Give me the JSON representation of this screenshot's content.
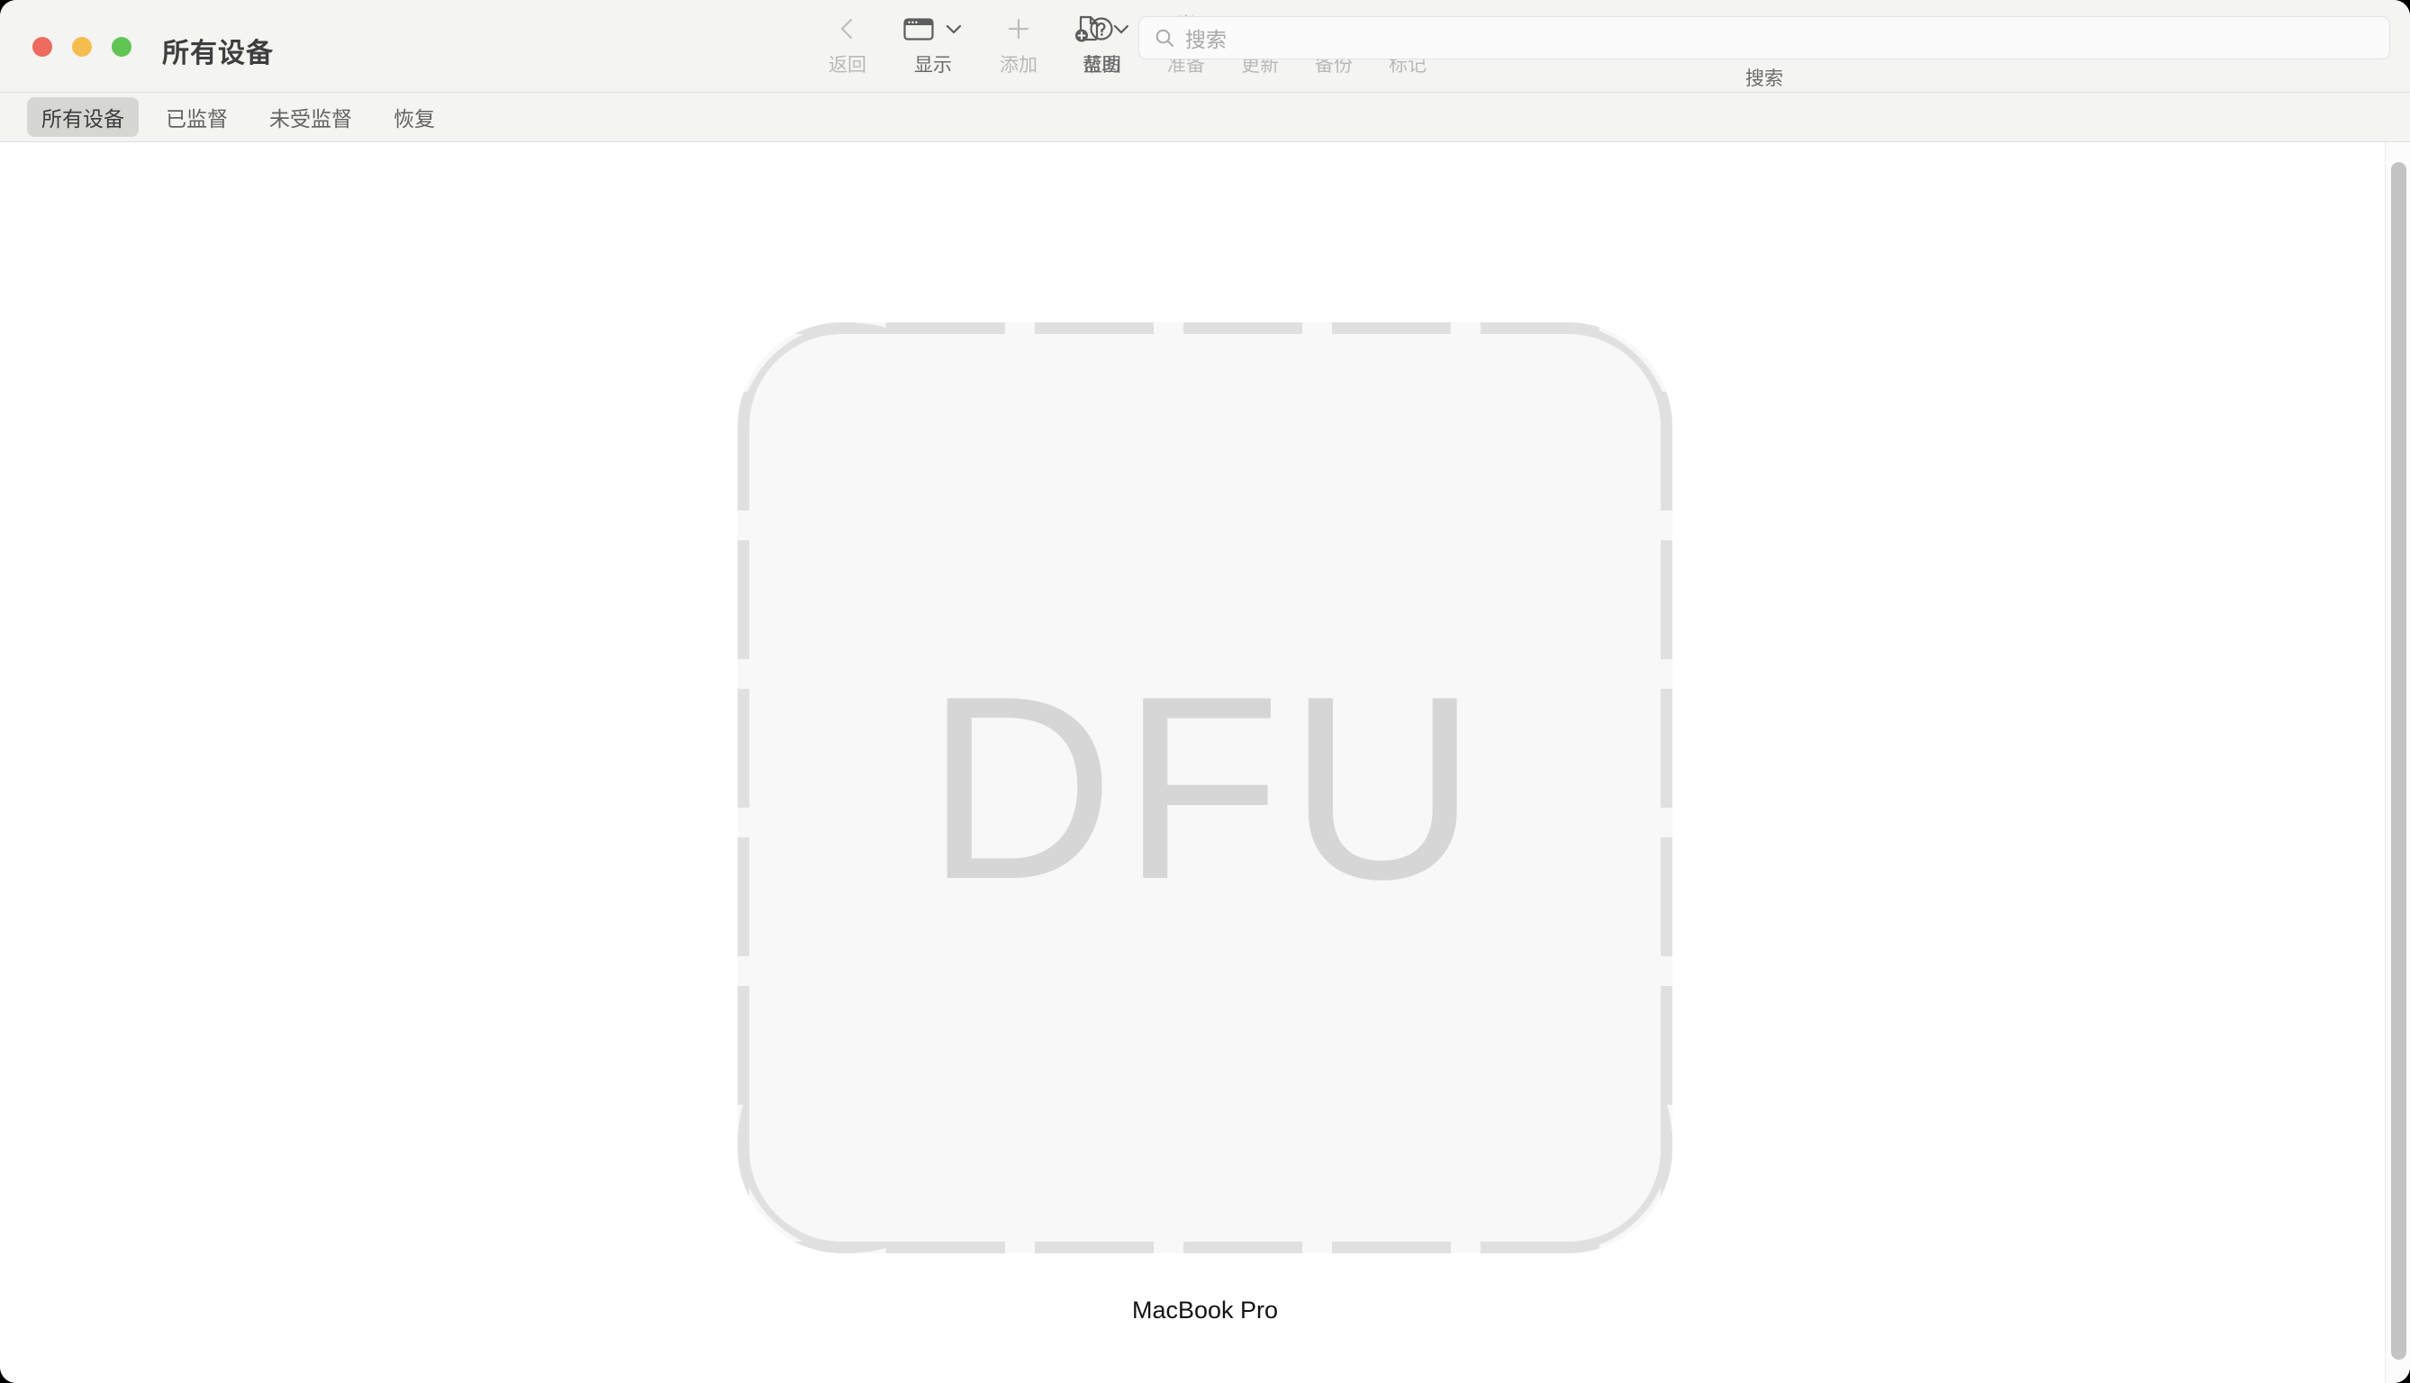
{
  "window": {
    "title": "所有设备",
    "traffic_lights": [
      {
        "name": "close",
        "color": "#ed6a5e"
      },
      {
        "name": "minimize",
        "color": "#f5bd4f"
      },
      {
        "name": "maximize",
        "color": "#61c554"
      }
    ]
  },
  "toolbar": {
    "items": [
      {
        "label": "返回",
        "icon": "chevron-left-icon",
        "enabled": false,
        "has_menu": false
      },
      {
        "label": "显示",
        "icon": "window-view-icon",
        "enabled": true,
        "has_menu": true
      },
      {
        "label": "添加",
        "icon": "plus-icon",
        "enabled": false,
        "has_menu": false
      },
      {
        "label": "蓝图",
        "icon": "blueprint-add-icon",
        "enabled": true,
        "has_menu": true
      },
      {
        "label": "准备",
        "icon": "gear-icon",
        "enabled": false,
        "has_menu": false
      },
      {
        "label": "更新",
        "icon": "download-tray-icon",
        "enabled": false,
        "has_menu": false
      },
      {
        "label": "备份",
        "icon": "arrow-up-circle-icon",
        "enabled": false,
        "has_menu": false
      },
      {
        "label": "标记",
        "icon": "tag-icon",
        "enabled": false,
        "has_menu": false
      }
    ],
    "help": {
      "label": "帮助",
      "icon": "question-circle-icon"
    },
    "search": {
      "label": "搜索",
      "placeholder": "搜索",
      "value": "",
      "icon": "search-icon"
    }
  },
  "tabs": [
    {
      "label": "所有设备",
      "active": true
    },
    {
      "label": "已监督",
      "active": false
    },
    {
      "label": "未受监督",
      "active": false
    },
    {
      "label": "恢复",
      "active": false
    }
  ],
  "content": {
    "device": {
      "state_text": "DFU",
      "name": "MacBook Pro"
    }
  },
  "colors": {
    "chrome_bg": "#f4f4f2",
    "content_bg": "#ffffff",
    "tab_active_bg": "#d6d6d4",
    "dashed_border": "#e0e0e0",
    "placeholder_fill": "#f8f8f8",
    "dfu_text": "#d6d6d6",
    "label_enabled": "#6b6b6b",
    "label_disabled": "#b9b9b9"
  }
}
